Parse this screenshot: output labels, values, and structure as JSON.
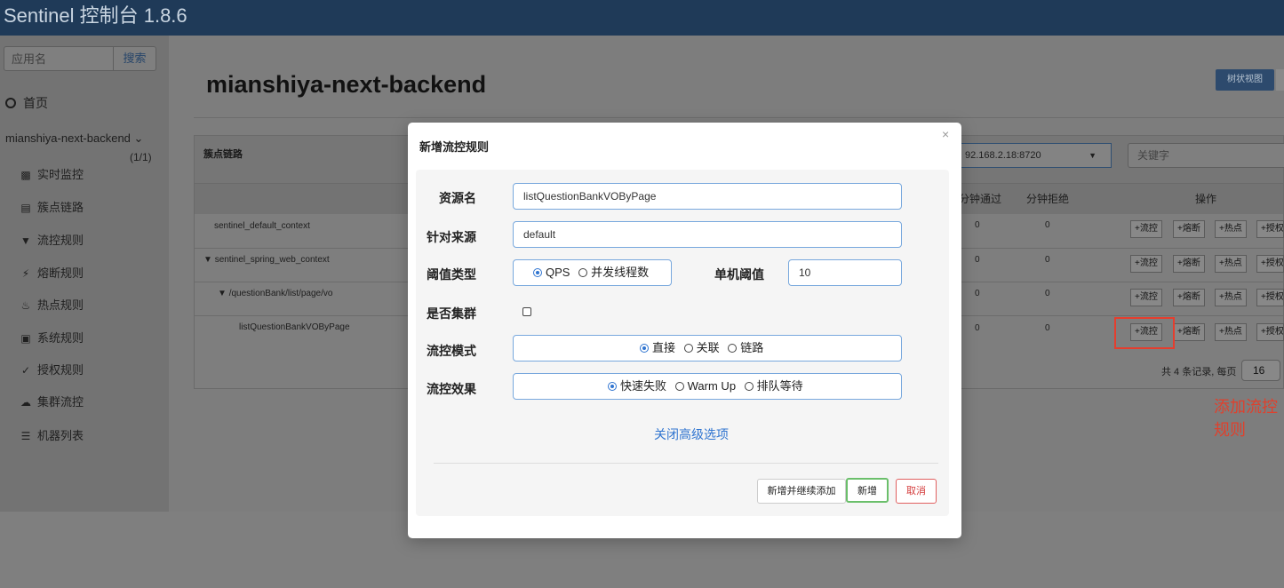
{
  "navbar": {
    "brand": "Sentinel 控制台 1.8.6"
  },
  "sidebar": {
    "search_placeholder": "应用名",
    "search_button": "搜索",
    "home": "首页",
    "app_name": "mianshiya-next-backend",
    "app_count": "(1/1)",
    "items": [
      {
        "label": "实时监控",
        "icon": "bar-chart-icon"
      },
      {
        "label": "簇点链路",
        "icon": "list-icon"
      },
      {
        "label": "流控规则",
        "icon": "filter-icon"
      },
      {
        "label": "熔断规则",
        "icon": "flash-icon"
      },
      {
        "label": "热点规则",
        "icon": "fire-icon"
      },
      {
        "label": "系统规则",
        "icon": "lock-icon"
      },
      {
        "label": "授权规则",
        "icon": "check-icon"
      },
      {
        "label": "集群流控",
        "icon": "cloud-icon"
      },
      {
        "label": "机器列表",
        "icon": "th-list-icon"
      }
    ]
  },
  "main": {
    "title": "mianshiya-next-backend",
    "view_button": "树状视图",
    "panel_title": "簇点链路",
    "machine": "92.168.2.18:8720",
    "keyword_placeholder": "关键字",
    "columns": {
      "pass": "分钟通过",
      "reject": "分钟拒绝",
      "ops": "操作"
    },
    "rows": [
      {
        "resource": "sentinel_default_context",
        "pass": "0",
        "reject": "0"
      },
      {
        "resource": "sentinel_spring_web_context",
        "pass": "0",
        "reject": "0"
      },
      {
        "resource": "/questionBank/list/page/vo",
        "pass": "0",
        "reject": "0"
      },
      {
        "resource": "listQuestionBankVOByPage",
        "pass": "0",
        "reject": "0"
      }
    ],
    "row_buttons": {
      "flow": "流控",
      "degrade": "熔断",
      "hot": "热点",
      "auth": "授权"
    },
    "annotation": "添加流控规则",
    "pager_text": "共 4 条记录, 每页",
    "page_size": "16"
  },
  "modal": {
    "title": "新增流控规则",
    "close": "×",
    "resource_label": "资源名",
    "resource_value": "listQuestionBankVOByPage",
    "origin_label": "针对来源",
    "origin_value": "default",
    "threshold_type_label": "阈值类型",
    "threshold_type_options": [
      "QPS",
      "并发线程数"
    ],
    "single_threshold_label": "单机阈值",
    "single_threshold_value": "10",
    "cluster_label": "是否集群",
    "mode_label": "流控模式",
    "mode_options": [
      "直接",
      "关联",
      "链路"
    ],
    "effect_label": "流控效果",
    "effect_options": [
      "快速失败",
      "Warm Up",
      "排队等待"
    ],
    "advanced_link": "关闭高级选项",
    "btn_continue": "新增并继续添加",
    "btn_add": "新增",
    "btn_cancel": "取消"
  }
}
